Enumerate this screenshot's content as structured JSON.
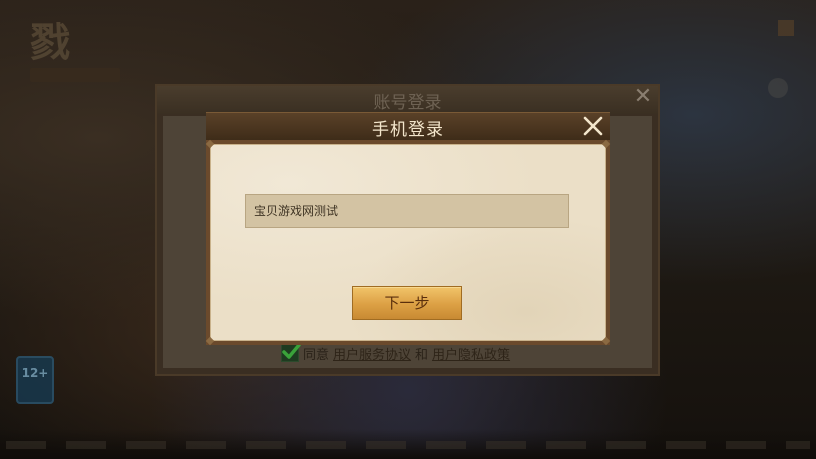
{
  "background_panel": {
    "title": "账号登录",
    "agree_prefix": "同意",
    "agree_link_terms": "用户服务协议",
    "agree_and": "和",
    "agree_link_privacy": "用户隐私政策",
    "agree_checked": true
  },
  "dialog": {
    "title": "手机登录",
    "phone_input_value": "宝贝游戏网测试",
    "next_button_label": "下一步"
  },
  "age_badge": "12+",
  "icons": {
    "close": "close-icon",
    "check": "checkmark-icon"
  },
  "colors": {
    "button_gold": "#dca044",
    "header_brown": "#4a3520",
    "parchment": "#ebdfc7",
    "checkbox_green": "#3aa23a"
  }
}
